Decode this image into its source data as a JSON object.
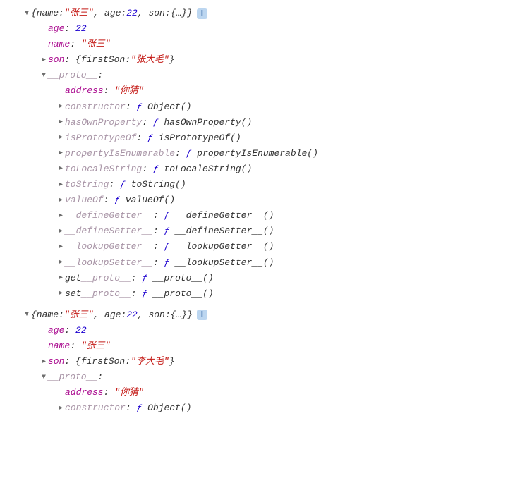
{
  "obj1": {
    "summary": {
      "pre": "{name: ",
      "name": "\"张三\"",
      "mid1": ", age: ",
      "age": "22",
      "mid2": ", son: ",
      "son": "{…}",
      "post": "}"
    },
    "age": {
      "key": "age",
      "val": "22"
    },
    "name": {
      "key": "name",
      "val": "\"张三\""
    },
    "son": {
      "key": "son",
      "pre": "{firstSon: ",
      "val": "\"张大毛\"",
      "post": "}"
    },
    "proto": {
      "key": "__proto__",
      "address": {
        "key": "address",
        "val": "\"你猜\""
      },
      "constructor": {
        "key": "constructor",
        "fn": "Object()"
      },
      "hasOwnProperty": {
        "key": "hasOwnProperty",
        "fn": "hasOwnProperty()"
      },
      "isPrototypeOf": {
        "key": "isPrototypeOf",
        "fn": "isPrototypeOf()"
      },
      "propertyIsEnumerable": {
        "key": "propertyIsEnumerable",
        "fn": "propertyIsEnumerable()"
      },
      "toLocaleString": {
        "key": "toLocaleString",
        "fn": "toLocaleString()"
      },
      "toString": {
        "key": "toString",
        "fn": "toString()"
      },
      "valueOf": {
        "key": "valueOf",
        "fn": "valueOf()"
      },
      "defineGetter": {
        "key": "__defineGetter__",
        "fn": "__defineGetter__()"
      },
      "defineSetter": {
        "key": "__defineSetter__",
        "fn": "__defineSetter__()"
      },
      "lookupGetter": {
        "key": "__lookupGetter__",
        "fn": "__lookupGetter__()"
      },
      "lookupSetter": {
        "key": "__lookupSetter__",
        "fn": "__lookupSetter__()"
      },
      "getProto": {
        "pre": "get ",
        "key": "__proto__",
        "fn": "__proto__()"
      },
      "setProto": {
        "pre": "set ",
        "key": "__proto__",
        "fn": "__proto__()"
      }
    }
  },
  "obj2": {
    "summary": {
      "pre": "{name: ",
      "name": "\"张三\"",
      "mid1": ", age: ",
      "age": "22",
      "mid2": ", son: ",
      "son": "{…}",
      "post": "}"
    },
    "age": {
      "key": "age",
      "val": "22"
    },
    "name": {
      "key": "name",
      "val": "\"张三\""
    },
    "son": {
      "key": "son",
      "pre": "{firstSon: ",
      "val": "\"李大毛\"",
      "post": "}"
    },
    "proto": {
      "key": "__proto__",
      "address": {
        "key": "address",
        "val": "\"你猜\""
      },
      "constructor": {
        "key": "constructor",
        "fn": "Object()"
      }
    }
  },
  "glyph": {
    "f": "ƒ",
    "info": "i",
    "down": "▼",
    "right": "▶"
  }
}
